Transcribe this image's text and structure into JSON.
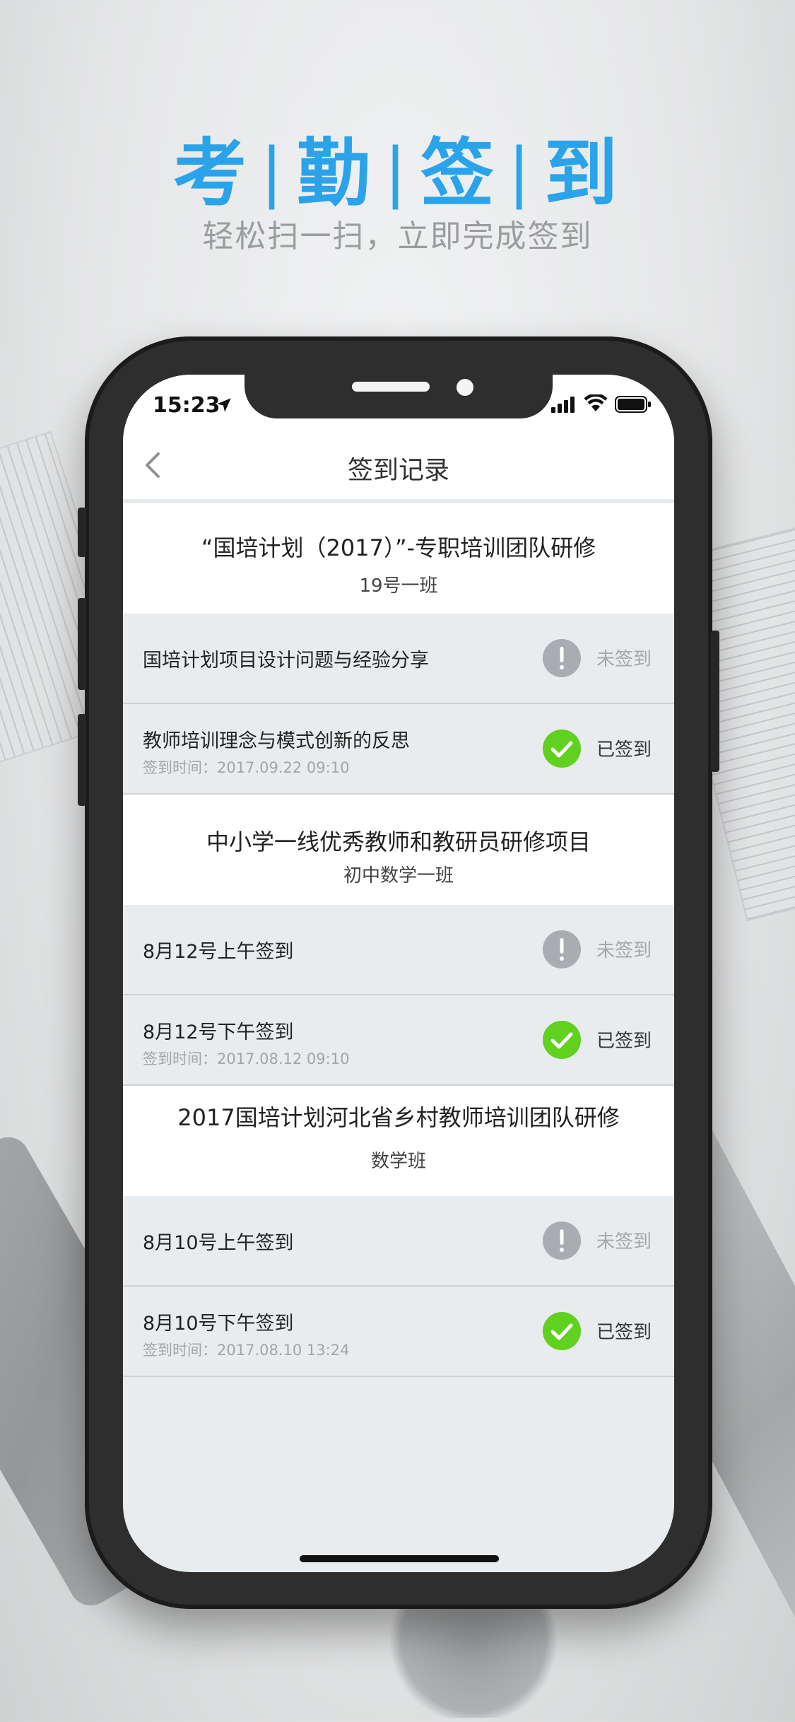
{
  "promo": {
    "headline_chars": [
      "考",
      "勤",
      "签",
      "到"
    ],
    "headline_separator": "|",
    "subline": "轻松扫一扫，立即完成签到"
  },
  "status_bar": {
    "time": "15:23"
  },
  "nav": {
    "title": "签到记录"
  },
  "groups": [
    {
      "title": "“国培计划（2017）”-专职培训团队研修",
      "subtitle": "19号一班",
      "items": [
        {
          "title": "国培计划项目设计问题与经验分享",
          "status": "未签到",
          "state": "unsigned",
          "time": ""
        },
        {
          "title": "教师培训理念与模式创新的反思",
          "status": "已签到",
          "state": "signed",
          "time": "签到时间：2017.09.22 09:10"
        }
      ]
    },
    {
      "title": "中小学一线优秀教师和教研员研修项目",
      "subtitle": "初中数学一班",
      "items": [
        {
          "title": "8月12号上午签到",
          "status": "未签到",
          "state": "unsigned",
          "time": ""
        },
        {
          "title": "8月12号下午签到",
          "status": "已签到",
          "state": "signed",
          "time": "签到时间：2017.08.12 09:10"
        }
      ]
    },
    {
      "title": "2017国培计划河北省乡村教师培训团队研修",
      "subtitle": "数学班",
      "items": [
        {
          "title": "8月10号上午签到",
          "status": "未签到",
          "state": "unsigned",
          "time": ""
        },
        {
          "title": "8月10号下午签到",
          "status": "已签到",
          "state": "signed",
          "time": "签到时间：2017.08.10 13:24"
        }
      ]
    }
  ],
  "colors": {
    "accent": "#2aa3ea",
    "signed_green": "#5fd11e",
    "unsigned_gray": "#a9acb0"
  }
}
